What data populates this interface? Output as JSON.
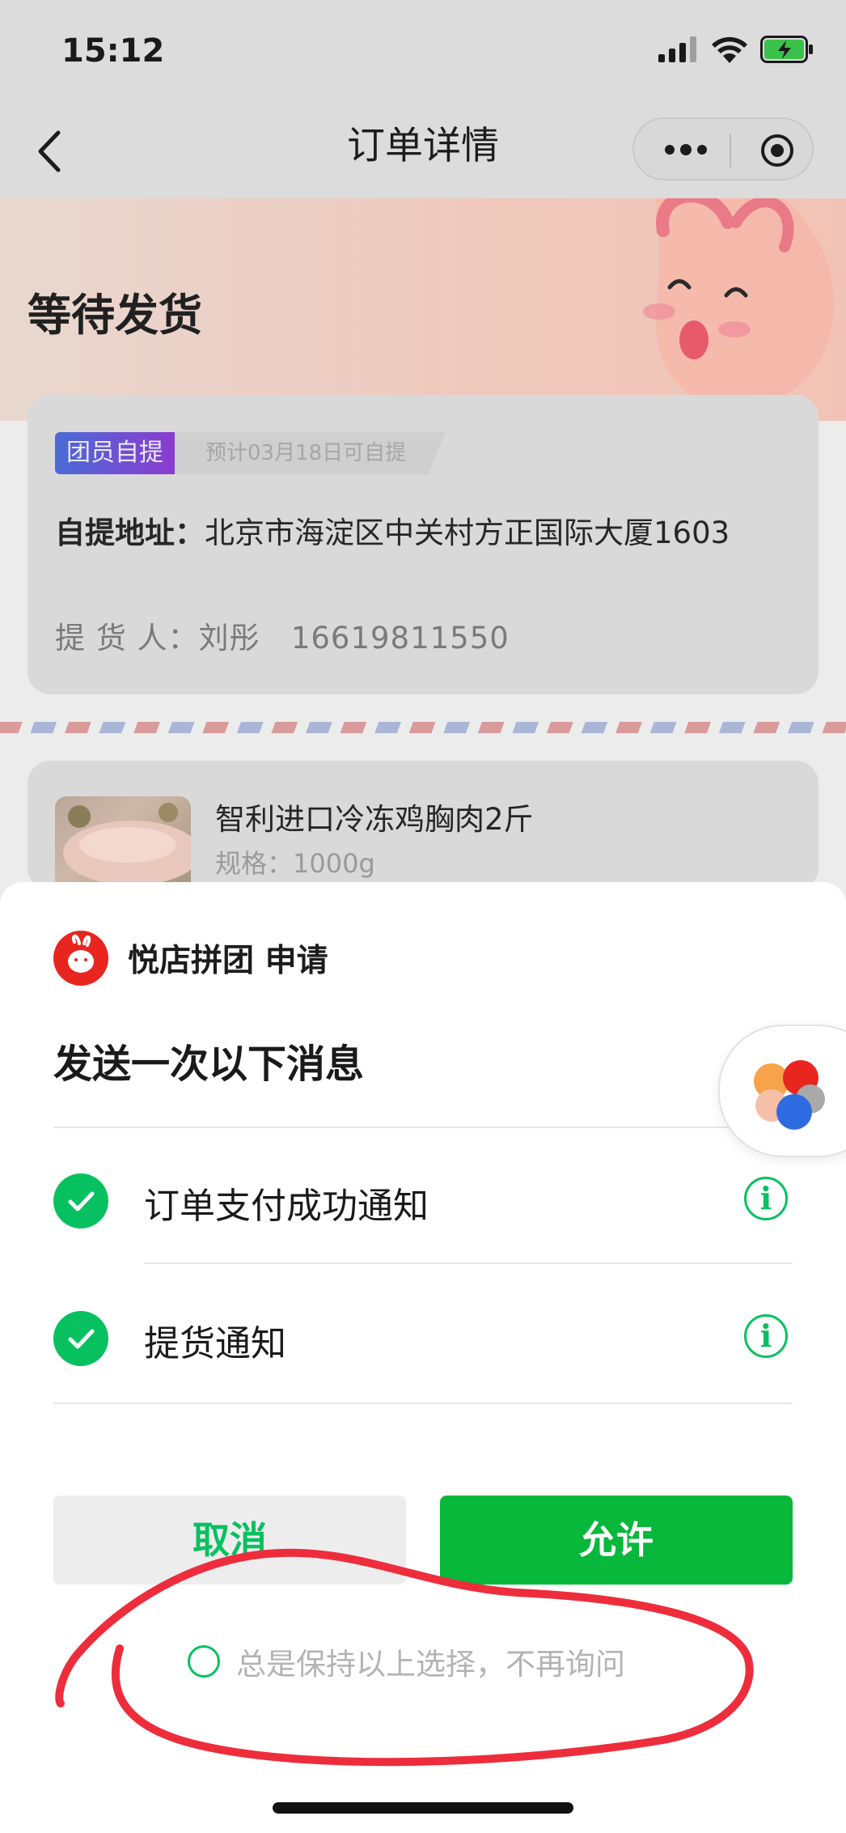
{
  "status_bar": {
    "time": "15:12"
  },
  "nav": {
    "title": "订单详情"
  },
  "banner": {
    "status_title": "等待发货"
  },
  "pickup": {
    "badge_type": "团员自提",
    "badge_eta": "预计03月18日可自提",
    "address_label": "自提地址：",
    "address_value": "北京市海淀区中关村方正国际大厦1603",
    "picker_label": "提 货 人：",
    "picker_name": "刘彤",
    "picker_phone": "16619811550"
  },
  "product": {
    "name": "智利进口冷冻鸡胸肉2斤",
    "spec": "规格：1000g"
  },
  "sheet": {
    "app_name": "悦店拼团 申请",
    "title": "发送一次以下消息",
    "permissions": [
      {
        "label": "订单支付成功通知",
        "checked": true
      },
      {
        "label": "提货通知",
        "checked": true
      }
    ],
    "cancel_label": "取消",
    "allow_label": "允许",
    "remember_label": "总是保持以上选择，不再询问"
  },
  "colors": {
    "accent_green": "#07c160",
    "allow_button": "#07b83a",
    "annotation_red": "#ee2d3c",
    "logo_red": "#e8251f"
  }
}
